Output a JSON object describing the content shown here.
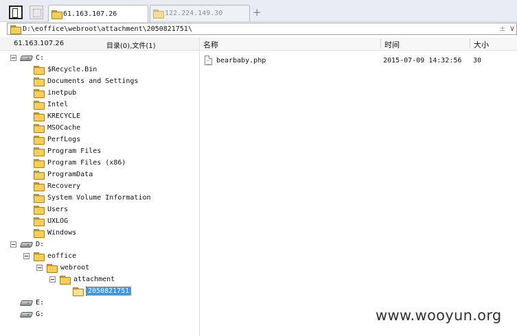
{
  "tabs": [
    {
      "label": "61.163.107.26",
      "active": true
    },
    {
      "label": "122.224.149.30",
      "active": false
    }
  ],
  "new_tab_label": "+",
  "address": {
    "path": "D:\\eoffice\\webroot\\attachment\\2050821751\\",
    "plus_glyph": "±",
    "chevron_glyph": "∨"
  },
  "left_panel": {
    "host": "61.163.107.26",
    "counts": "目录(0),文件(1)"
  },
  "tree": [
    {
      "label": "C:",
      "type": "drive",
      "depth": 0,
      "expanded": true
    },
    {
      "label": "$Recycle.Bin",
      "type": "folder",
      "depth": 1
    },
    {
      "label": "Documents and Settings",
      "type": "folder",
      "depth": 1
    },
    {
      "label": "inetpub",
      "type": "folder",
      "depth": 1
    },
    {
      "label": "Intel",
      "type": "folder",
      "depth": 1
    },
    {
      "label": "KRECYCLE",
      "type": "folder",
      "depth": 1
    },
    {
      "label": "MSOCache",
      "type": "folder",
      "depth": 1
    },
    {
      "label": "PerfLogs",
      "type": "folder",
      "depth": 1
    },
    {
      "label": "Program Files",
      "type": "folder",
      "depth": 1
    },
    {
      "label": "Program Files (x86)",
      "type": "folder",
      "depth": 1
    },
    {
      "label": "ProgramData",
      "type": "folder",
      "depth": 1
    },
    {
      "label": "Recovery",
      "type": "folder",
      "depth": 1
    },
    {
      "label": "System Volume Information",
      "type": "folder",
      "depth": 1
    },
    {
      "label": "Users",
      "type": "folder",
      "depth": 1
    },
    {
      "label": "UXLOG",
      "type": "folder",
      "depth": 1
    },
    {
      "label": "Windows",
      "type": "folder",
      "depth": 1
    },
    {
      "label": "D:",
      "type": "drive",
      "depth": 0,
      "expanded": true
    },
    {
      "label": "eoffice",
      "type": "folder",
      "depth": 1,
      "expanded": true
    },
    {
      "label": "webroot",
      "type": "folder",
      "depth": 2,
      "expanded": true
    },
    {
      "label": "attachment",
      "type": "folder",
      "depth": 3,
      "expanded": true
    },
    {
      "label": "2050821751",
      "type": "folder-open",
      "depth": 4,
      "selected": true
    },
    {
      "label": "E:",
      "type": "drive",
      "depth": 0
    },
    {
      "label": "G:",
      "type": "drive",
      "depth": 0
    }
  ],
  "file_list": {
    "columns": {
      "name": "名称",
      "time": "时间",
      "size": "大小"
    },
    "rows": [
      {
        "name": "bearbaby.php",
        "time": "2015-07-09 14:32:56",
        "size": "30"
      }
    ]
  },
  "watermark": "www.wooyun.org",
  "colors": {
    "selection": "#3399ff",
    "folder": "#f5cf5a"
  }
}
